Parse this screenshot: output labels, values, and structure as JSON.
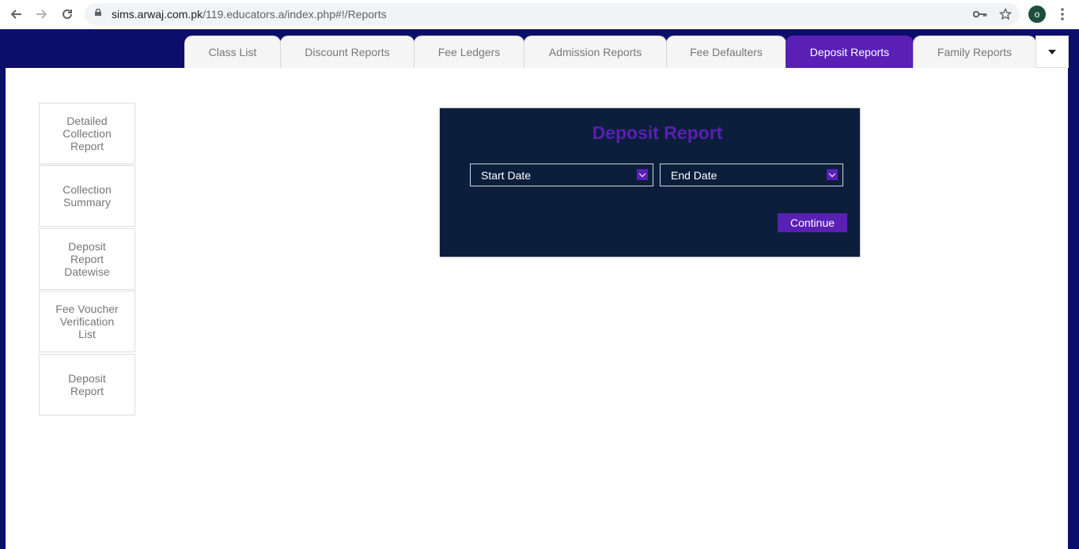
{
  "browser": {
    "url_host": "sims.arwaj.com.pk",
    "url_path": "/119.educators.a/index.php#!/Reports",
    "profile_initial": "o"
  },
  "tabs": [
    {
      "label": "Class List"
    },
    {
      "label": "Discount Reports"
    },
    {
      "label": "Fee Ledgers"
    },
    {
      "label": "Admission Reports"
    },
    {
      "label": "Fee Defaulters"
    },
    {
      "label": "Deposit Reports",
      "active": true
    },
    {
      "label": "Family Reports"
    }
  ],
  "sidebar": {
    "items": [
      {
        "label": "Detailed Collection Report"
      },
      {
        "label": "Collection Summary"
      },
      {
        "label": "Deposit Report Datewise"
      },
      {
        "label": "Fee Voucher Verification List"
      },
      {
        "label": "Deposit Report"
      }
    ]
  },
  "panel": {
    "title": "Deposit Report",
    "start_date": "Start Date",
    "end_date": "End Date",
    "continue": "Continue"
  },
  "colors": {
    "accent": "#5a1fb4",
    "panel_bg": "#0b1f3c",
    "frame_bg": "#0d0d6b"
  }
}
